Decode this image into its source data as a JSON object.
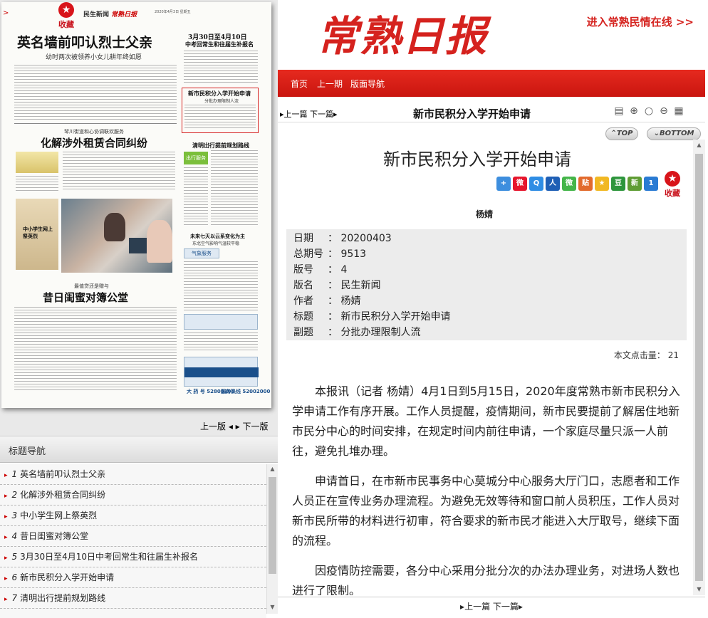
{
  "paper": {
    "fav_label": "收藏",
    "masthead": "民生新闻",
    "masthead_logo": "常熟日报",
    "date_line": "2020年4月3日 星期五",
    "headline1": "英名墙前叩认烈士父亲",
    "headline1_sub": "幼时两次被领养小女儿耕年终如愿",
    "box_title": "3月30日至4月10日",
    "box_sub": "中考回常生和往届生补报名",
    "highlight_title": "新市民积分入学开始申请",
    "highlight_sub": "分批办理限制人流",
    "headline2_kicker": "琴川街道和心协调联欢服务",
    "headline2": "化解涉外租赁合同纠纷",
    "qingming_title": "清明出行提前规划路线",
    "students_label": "中小学生网上祭英烈",
    "weather_title": "未来七天以云系变化为主",
    "weather_sub": "东北空气影响气温较平稳",
    "headline3_kicker": "最值贷还是赠与",
    "headline3": "昔日闺蜜对簿公堂",
    "service_logo": "出行服务",
    "weather_service": "气象服务",
    "hotline1": "大 药 号 52800101",
    "hotline2": "服务热线 52002000"
  },
  "pager": {
    "prev": "上一版",
    "next": "下一版"
  },
  "nav": {
    "title": "标题导航",
    "items": [
      {
        "num": "1",
        "label": "英名墙前叩认烈士父亲"
      },
      {
        "num": "2",
        "label": "化解涉外租赁合同纠纷"
      },
      {
        "num": "3",
        "label": "中小学生网上祭英烈"
      },
      {
        "num": "4",
        "label": "昔日闺蜜对簿公堂"
      },
      {
        "num": "5",
        "label": "3月30日至4月10日中考回常生和往届生补报名"
      },
      {
        "num": "6",
        "label": "新市民积分入学开始申请"
      },
      {
        "num": "7",
        "label": "清明出行提前规划路线"
      }
    ]
  },
  "header": {
    "logo": "常熟日报",
    "enter_link": "进入常熟民情在线 >>",
    "menu": [
      "首页",
      "上一期",
      "版面导航"
    ]
  },
  "toolbar": {
    "prev": "上一篇",
    "next": "下一篇",
    "title": "新市民积分入学开始申请",
    "icons": [
      "notepad-icon",
      "zoom-in-icon",
      "zoom-icon",
      "zoom-out-icon",
      "print-icon"
    ]
  },
  "scroll_buttons": {
    "top": "TOP",
    "bottom": "BOTTOM"
  },
  "article": {
    "title": "新市民积分入学开始申请",
    "author": "杨婧",
    "fav_label": "收藏",
    "share_icons": [
      {
        "name": "more-share-icon",
        "glyph": "+",
        "color": "#3d8ede"
      },
      {
        "name": "weibo-icon",
        "glyph": "微",
        "color": "#e6162d"
      },
      {
        "name": "qzone-icon",
        "glyph": "Q",
        "color": "#2f8de4"
      },
      {
        "name": "renren-icon",
        "glyph": "人",
        "color": "#1f5fb5"
      },
      {
        "name": "wechat-icon",
        "glyph": "微",
        "color": "#44b549"
      },
      {
        "name": "tieba-icon",
        "glyph": "贴",
        "color": "#e26a2c"
      },
      {
        "name": "star-share-icon",
        "glyph": "★",
        "color": "#f1b823"
      },
      {
        "name": "douban-icon",
        "glyph": "豆",
        "color": "#2e963d"
      },
      {
        "name": "sina-icon",
        "glyph": "新",
        "color": "#5f9d34"
      },
      {
        "name": "one-icon",
        "glyph": "1",
        "color": "#2a7bd3"
      }
    ],
    "meta": [
      {
        "label": "日期",
        "value": "20200403"
      },
      {
        "label": "总期号",
        "value": "9513"
      },
      {
        "label": "版号",
        "value": "4"
      },
      {
        "label": "版名",
        "value": "民生新闻"
      },
      {
        "label": "作者",
        "value": "杨婧"
      },
      {
        "label": "标题",
        "value": "新市民积分入学开始申请"
      },
      {
        "label": "副题",
        "value": "分批办理限制人流"
      }
    ],
    "views_label": "本文点击量：",
    "views": "21",
    "paragraphs": [
      "本报讯（记者 杨婧）4月1日到5月15日，2020年度常熟市新市民积分入学申请工作有序开展。工作人员提醒，疫情期间，新市民要提前了解居住地新市民分中心的时间安排，在规定时间内前往申请，一个家庭尽量只派一人前往，避免扎堆办理。",
      "申请首日，在市新市民事务中心莫城分中心服务大厅门口，志愿者和工作人员正在宣传业务办理流程。为避免无效等待和窗口前人员积压，工作人员对新市民所带的材料进行初审，符合要求的新市民才能进入大厅取号，继续下面的流程。",
      "因疫情防控需要，各分中心采用分批分次的办法办理业务，对进场人数也进行了限制。"
    ]
  },
  "bottom_nav": {
    "prev": "上一篇",
    "next": "下一篇"
  },
  "colors": {
    "brand_red": "#d5221e",
    "menu_bar": "#d81e17",
    "meta_bg": "#ececec"
  }
}
